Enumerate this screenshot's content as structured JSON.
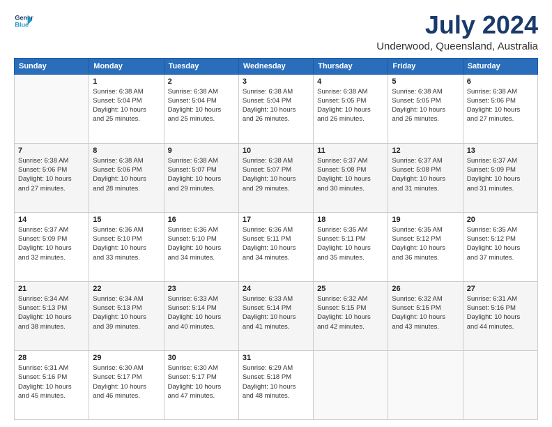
{
  "header": {
    "logo_line1": "General",
    "logo_line2": "Blue",
    "title": "July 2024",
    "subtitle": "Underwood, Queensland, Australia"
  },
  "calendar": {
    "headers": [
      "Sunday",
      "Monday",
      "Tuesday",
      "Wednesday",
      "Thursday",
      "Friday",
      "Saturday"
    ],
    "weeks": [
      [
        {
          "day": "",
          "info": ""
        },
        {
          "day": "1",
          "info": "Sunrise: 6:38 AM\nSunset: 5:04 PM\nDaylight: 10 hours\nand 25 minutes."
        },
        {
          "day": "2",
          "info": "Sunrise: 6:38 AM\nSunset: 5:04 PM\nDaylight: 10 hours\nand 25 minutes."
        },
        {
          "day": "3",
          "info": "Sunrise: 6:38 AM\nSunset: 5:04 PM\nDaylight: 10 hours\nand 26 minutes."
        },
        {
          "day": "4",
          "info": "Sunrise: 6:38 AM\nSunset: 5:05 PM\nDaylight: 10 hours\nand 26 minutes."
        },
        {
          "day": "5",
          "info": "Sunrise: 6:38 AM\nSunset: 5:05 PM\nDaylight: 10 hours\nand 26 minutes."
        },
        {
          "day": "6",
          "info": "Sunrise: 6:38 AM\nSunset: 5:06 PM\nDaylight: 10 hours\nand 27 minutes."
        }
      ],
      [
        {
          "day": "7",
          "info": "Sunrise: 6:38 AM\nSunset: 5:06 PM\nDaylight: 10 hours\nand 27 minutes."
        },
        {
          "day": "8",
          "info": "Sunrise: 6:38 AM\nSunset: 5:06 PM\nDaylight: 10 hours\nand 28 minutes."
        },
        {
          "day": "9",
          "info": "Sunrise: 6:38 AM\nSunset: 5:07 PM\nDaylight: 10 hours\nand 29 minutes."
        },
        {
          "day": "10",
          "info": "Sunrise: 6:38 AM\nSunset: 5:07 PM\nDaylight: 10 hours\nand 29 minutes."
        },
        {
          "day": "11",
          "info": "Sunrise: 6:37 AM\nSunset: 5:08 PM\nDaylight: 10 hours\nand 30 minutes."
        },
        {
          "day": "12",
          "info": "Sunrise: 6:37 AM\nSunset: 5:08 PM\nDaylight: 10 hours\nand 31 minutes."
        },
        {
          "day": "13",
          "info": "Sunrise: 6:37 AM\nSunset: 5:09 PM\nDaylight: 10 hours\nand 31 minutes."
        }
      ],
      [
        {
          "day": "14",
          "info": "Sunrise: 6:37 AM\nSunset: 5:09 PM\nDaylight: 10 hours\nand 32 minutes."
        },
        {
          "day": "15",
          "info": "Sunrise: 6:36 AM\nSunset: 5:10 PM\nDaylight: 10 hours\nand 33 minutes."
        },
        {
          "day": "16",
          "info": "Sunrise: 6:36 AM\nSunset: 5:10 PM\nDaylight: 10 hours\nand 34 minutes."
        },
        {
          "day": "17",
          "info": "Sunrise: 6:36 AM\nSunset: 5:11 PM\nDaylight: 10 hours\nand 34 minutes."
        },
        {
          "day": "18",
          "info": "Sunrise: 6:35 AM\nSunset: 5:11 PM\nDaylight: 10 hours\nand 35 minutes."
        },
        {
          "day": "19",
          "info": "Sunrise: 6:35 AM\nSunset: 5:12 PM\nDaylight: 10 hours\nand 36 minutes."
        },
        {
          "day": "20",
          "info": "Sunrise: 6:35 AM\nSunset: 5:12 PM\nDaylight: 10 hours\nand 37 minutes."
        }
      ],
      [
        {
          "day": "21",
          "info": "Sunrise: 6:34 AM\nSunset: 5:13 PM\nDaylight: 10 hours\nand 38 minutes."
        },
        {
          "day": "22",
          "info": "Sunrise: 6:34 AM\nSunset: 5:13 PM\nDaylight: 10 hours\nand 39 minutes."
        },
        {
          "day": "23",
          "info": "Sunrise: 6:33 AM\nSunset: 5:14 PM\nDaylight: 10 hours\nand 40 minutes."
        },
        {
          "day": "24",
          "info": "Sunrise: 6:33 AM\nSunset: 5:14 PM\nDaylight: 10 hours\nand 41 minutes."
        },
        {
          "day": "25",
          "info": "Sunrise: 6:32 AM\nSunset: 5:15 PM\nDaylight: 10 hours\nand 42 minutes."
        },
        {
          "day": "26",
          "info": "Sunrise: 6:32 AM\nSunset: 5:15 PM\nDaylight: 10 hours\nand 43 minutes."
        },
        {
          "day": "27",
          "info": "Sunrise: 6:31 AM\nSunset: 5:16 PM\nDaylight: 10 hours\nand 44 minutes."
        }
      ],
      [
        {
          "day": "28",
          "info": "Sunrise: 6:31 AM\nSunset: 5:16 PM\nDaylight: 10 hours\nand 45 minutes."
        },
        {
          "day": "29",
          "info": "Sunrise: 6:30 AM\nSunset: 5:17 PM\nDaylight: 10 hours\nand 46 minutes."
        },
        {
          "day": "30",
          "info": "Sunrise: 6:30 AM\nSunset: 5:17 PM\nDaylight: 10 hours\nand 47 minutes."
        },
        {
          "day": "31",
          "info": "Sunrise: 6:29 AM\nSunset: 5:18 PM\nDaylight: 10 hours\nand 48 minutes."
        },
        {
          "day": "",
          "info": ""
        },
        {
          "day": "",
          "info": ""
        },
        {
          "day": "",
          "info": ""
        }
      ]
    ]
  }
}
